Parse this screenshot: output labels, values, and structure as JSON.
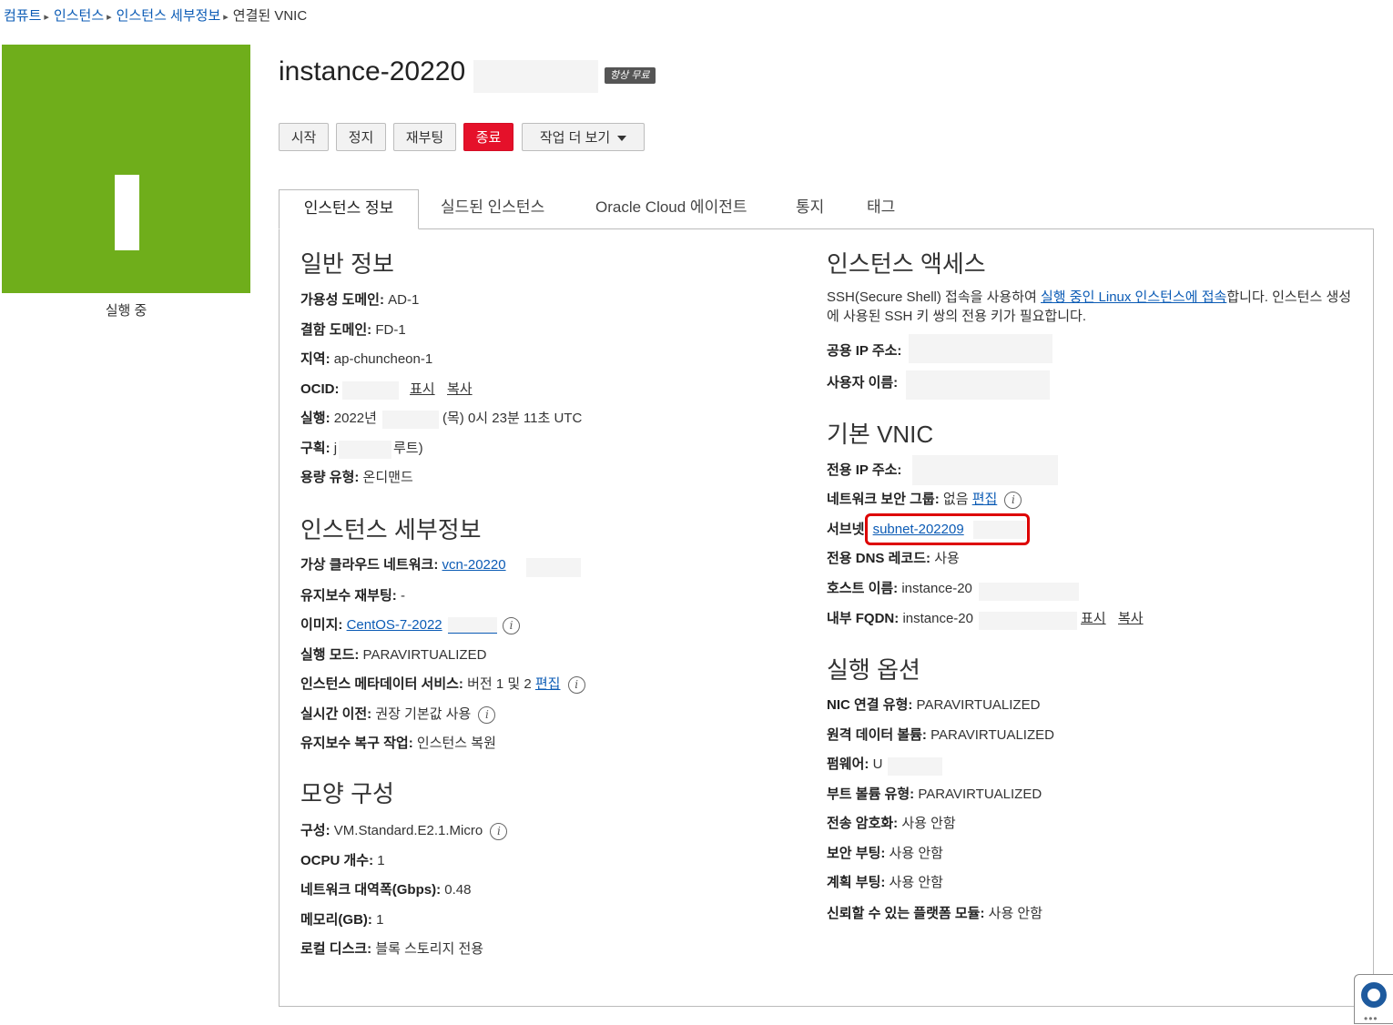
{
  "breadcrumb": {
    "items": [
      "컴퓨트",
      "인스턴스",
      "인스턴스 세부정보"
    ],
    "current": "연결된 VNIC"
  },
  "instance": {
    "letter": "I",
    "status": "실행 중",
    "title": "instance-20220",
    "badge": "항상 무료"
  },
  "actions": {
    "start": "시작",
    "stop": "정지",
    "reboot": "재부팅",
    "terminate": "종료",
    "more": "작업 더 보기"
  },
  "tabs": [
    "인스턴스 정보",
    "실드된 인스턴스",
    "Oracle Cloud 에이전트",
    "통지",
    "태그"
  ],
  "general": {
    "title": "일반 정보",
    "ad_label": "가용성 도메인:",
    "ad_value": "AD-1",
    "fd_label": "결함 도메인:",
    "fd_value": "FD-1",
    "region_label": "지역:",
    "region_value": "ap-chuncheon-1",
    "ocid_label": "OCID:",
    "ocid_show": "표시",
    "ocid_copy": "복사",
    "launched_label": "실행:",
    "launched_value1": "2022년",
    "launched_value2": "(목) 0시 23분 11초 UTC",
    "compartment_label": "구획:",
    "compartment_value1": "j",
    "compartment_value2": "루트)",
    "capacity_label": "용량 유형:",
    "capacity_value": "온디맨드"
  },
  "details": {
    "title": "인스턴스 세부정보",
    "vcn_label": "가상 클라우드 네트워크:",
    "vcn_value": "vcn-20220",
    "maint_label": "유지보수 재부팅:",
    "maint_value": "-",
    "image_label": "이미지:",
    "image_value": "CentOS-7-2022",
    "mode_label": "실행 모드:",
    "mode_value": "PARAVIRTUALIZED",
    "metadata_label": "인스턴스 메타데이터 서비스:",
    "metadata_value": "버전 1 및 2",
    "metadata_edit": "편집",
    "migration_label": "실시간 이전:",
    "migration_value": "권장 기본값 사용",
    "recovery_label": "유지보수 복구 작업:",
    "recovery_value": "인스턴스 복원"
  },
  "shape": {
    "title": "모양 구성",
    "shape_label": "구성:",
    "shape_value": "VM.Standard.E2.1.Micro",
    "ocpu_label": "OCPU 개수:",
    "ocpu_value": "1",
    "bw_label": "네트워크 대역폭(Gbps):",
    "bw_value": "0.48",
    "mem_label": "메모리(GB):",
    "mem_value": "1",
    "disk_label": "로컬 디스크:",
    "disk_value": "블록 스토리지 전용"
  },
  "access": {
    "title": "인스턴스 액세스",
    "desc_part1": "SSH(Secure Shell) 접속을 사용하여 ",
    "desc_link": "실행 중인 Linux 인스턴스에 접속",
    "desc_part2": "합니다. 인스턴스 생성에 사용된 SSH 키 쌍의 전용 키가 필요합니다.",
    "public_ip_label": "공용 IP 주소:",
    "username_label": "사용자 이름:"
  },
  "vnic": {
    "title": "기본 VNIC",
    "private_ip_label": "전용 IP 주소:",
    "nsg_label": "네트워크 보안 그룹:",
    "nsg_value": "없음",
    "nsg_edit": "편집",
    "subnet_label": "서브넷:",
    "subnet_value": "subnet-202209",
    "dns_label": "전용 DNS 레코드:",
    "dns_value": "사용",
    "host_label": "호스트 이름:",
    "host_value": "instance-20",
    "fqdn_label": "내부 FQDN:",
    "fqdn_value": "instance-20",
    "fqdn_show": "표시",
    "fqdn_copy": "복사"
  },
  "launch": {
    "title": "실행 옵션",
    "nic_label": "NIC 연결 유형:",
    "nic_value": "PARAVIRTUALIZED",
    "remote_label": "원격 데이터 볼륨:",
    "remote_value": "PARAVIRTUALIZED",
    "firmware_label": "펌웨어:",
    "firmware_value": "U",
    "boot_label": "부트 볼륨 유형:",
    "boot_value": "PARAVIRTUALIZED",
    "encrypt_label": "전송 암호화:",
    "encrypt_value": "사용 안함",
    "secure_label": "보안 부팅:",
    "secure_value": "사용 안함",
    "measured_label": "계획 부팅:",
    "measured_value": "사용 안함",
    "tpm_label": "신뢰할 수 있는 플랫폼 모듈:",
    "tpm_value": "사용 안함"
  }
}
